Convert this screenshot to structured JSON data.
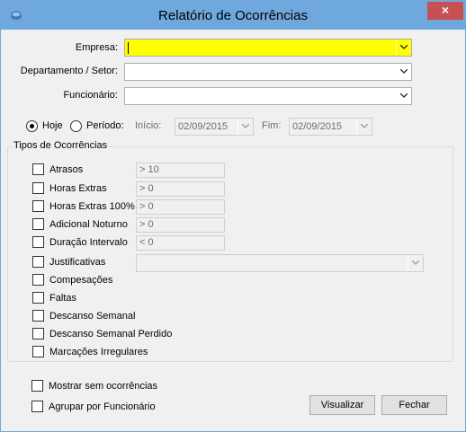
{
  "window": {
    "title": "Relatório de Ocorrências",
    "close_glyph": "×",
    "icon": "app-icon"
  },
  "filters": {
    "empresa_label": "Empresa:",
    "empresa_value": "",
    "departamento_label": "Departamento / Setor:",
    "departamento_value": "",
    "funcionario_label": "Funcionário:",
    "funcionario_value": ""
  },
  "period": {
    "hoje_label": "Hoje",
    "hoje_selected": true,
    "periodo_label": "Período:",
    "inicio_label": "Início:",
    "inicio_value": "02/09/2015",
    "fim_label": "Fim:",
    "fim_value": "02/09/2015"
  },
  "tipos": {
    "title": "Tipos de Ocorrências",
    "items": [
      {
        "label": "Atrasos",
        "checked": false,
        "field": "> 10"
      },
      {
        "label": "Horas Extras",
        "checked": false,
        "field": "> 0"
      },
      {
        "label": "Horas Extras 100%",
        "checked": false,
        "field": "> 0"
      },
      {
        "label": "Adicional Noturno",
        "checked": false,
        "field": "> 0"
      },
      {
        "label": "Duração Intervalo",
        "checked": false,
        "field": "< 0"
      },
      {
        "label": "Justificativas",
        "checked": false,
        "field": ""
      },
      {
        "label": "Compesações",
        "checked": false
      },
      {
        "label": "Faltas",
        "checked": false
      },
      {
        "label": "Descanso Semanal",
        "checked": false
      },
      {
        "label": "Descanso Semanal Perdido",
        "checked": false
      },
      {
        "label": "Marcações Irregulares",
        "checked": false
      }
    ]
  },
  "options": {
    "mostrar_label": "Mostrar sem ocorrências",
    "agrupar_label": "Agrupar por Funcionário"
  },
  "buttons": {
    "visualizar": "Visualizar",
    "fechar": "Fechar"
  },
  "colors": {
    "titlebar": "#6fa8dc",
    "empresa_highlight": "#ffff00",
    "close": "#c75050"
  }
}
